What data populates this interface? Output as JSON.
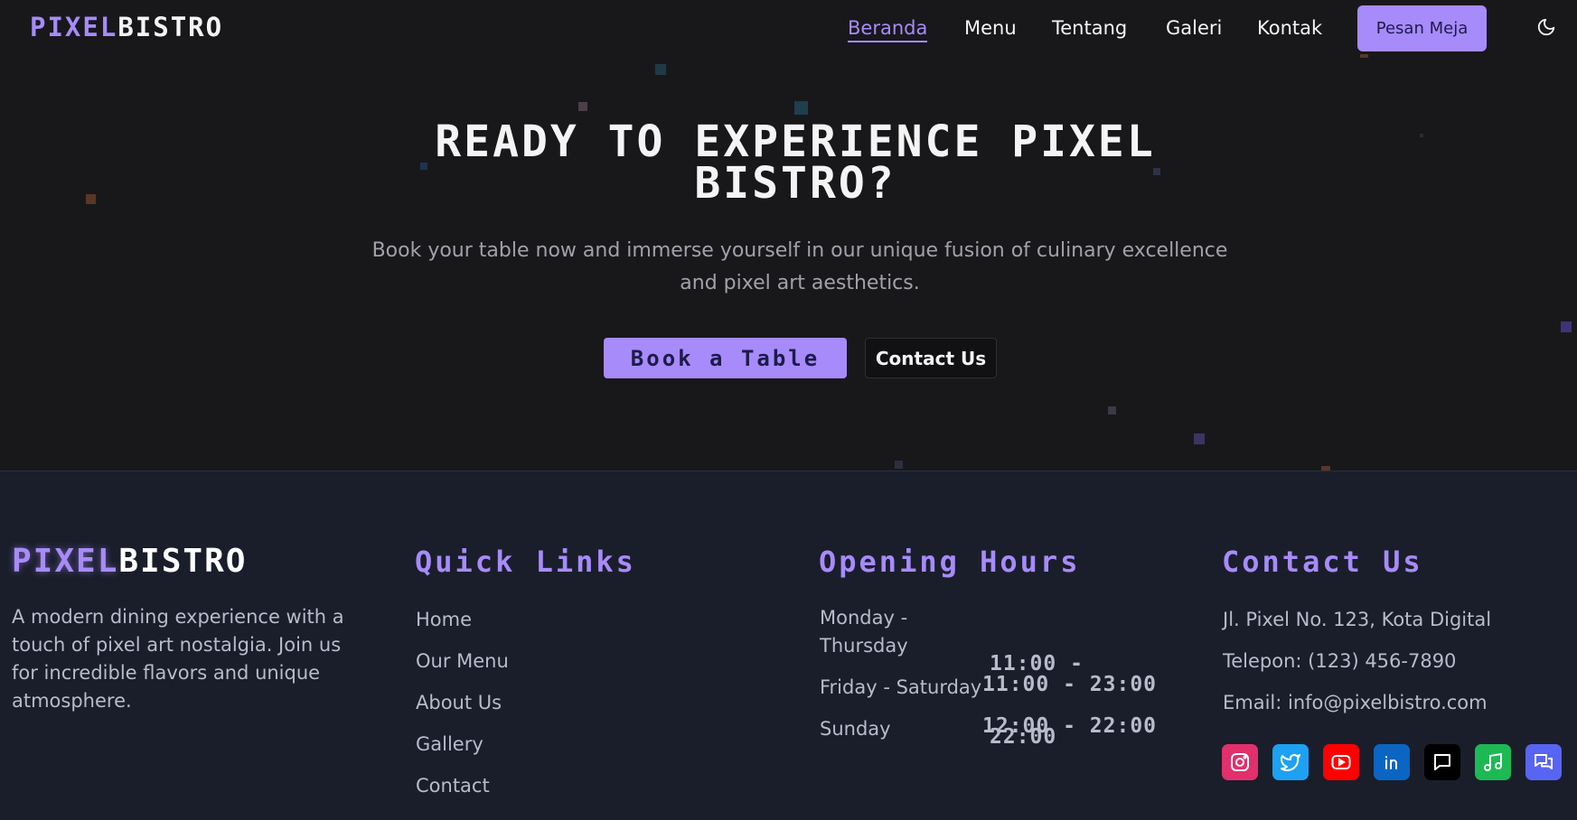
{
  "header": {
    "logo_part1": "PIXEL",
    "logo_part2": "BISTRO",
    "nav": [
      "Beranda",
      "Menu",
      "Tentang",
      "Galeri",
      "Kontak"
    ],
    "cta_label": "Pesan Meja",
    "theme_toggle_icon": "moon-icon"
  },
  "hero": {
    "title_line1": "READY TO EXPERIENCE PIXEL",
    "title_line2": "BISTRO?",
    "subtitle_line1": "Book your table now and immerse yourself in our unique fusion of culinary excellence",
    "subtitle_line2": "and pixel art aesthetics.",
    "primary_button": "Book a Table",
    "secondary_button": "Contact Us"
  },
  "footer": {
    "brand": {
      "logo_part1": "PIXEL",
      "logo_part2": "BISTRO",
      "description": "A modern dining experience with a touch of pixel art nostalgia. Join us for incredible flavors and unique atmosphere."
    },
    "quick_links": {
      "heading": "Quick Links",
      "items": [
        "Home",
        "Our Menu",
        "About Us",
        "Gallery",
        "Contact"
      ]
    },
    "hours": {
      "heading": "Opening Hours",
      "rows": [
        {
          "day_line1": "Monday -",
          "day_line2": "Thursday",
          "time_line1": "11:00 -",
          "time_line2": "22:00"
        },
        {
          "day": "Friday - Saturday",
          "time": "11:00 - 23:00"
        },
        {
          "day": "Sunday",
          "time": "12:00 - 22:00"
        }
      ]
    },
    "contact": {
      "heading": "Contact Us",
      "address": "Jl. Pixel No. 123, Kota Digital",
      "phone": "Telepon: (123) 456-7890",
      "email": "Email: info@pixelbistro.com",
      "socials": [
        {
          "icon": "instagram-icon",
          "color": "#e1306c"
        },
        {
          "icon": "twitter-icon",
          "color": "#1da1f2"
        },
        {
          "icon": "youtube-icon",
          "color": "#ff0000"
        },
        {
          "icon": "linkedin-icon",
          "color": "#0a66c2"
        },
        {
          "icon": "chat-icon",
          "color": "#000000"
        },
        {
          "icon": "music-icon",
          "color": "#1db954"
        },
        {
          "icon": "discord-icon",
          "color": "#5865f2"
        }
      ]
    }
  },
  "colors": {
    "accent": "#a78bfa",
    "background": "#18181b",
    "footer_background": "#1a1e2b"
  }
}
